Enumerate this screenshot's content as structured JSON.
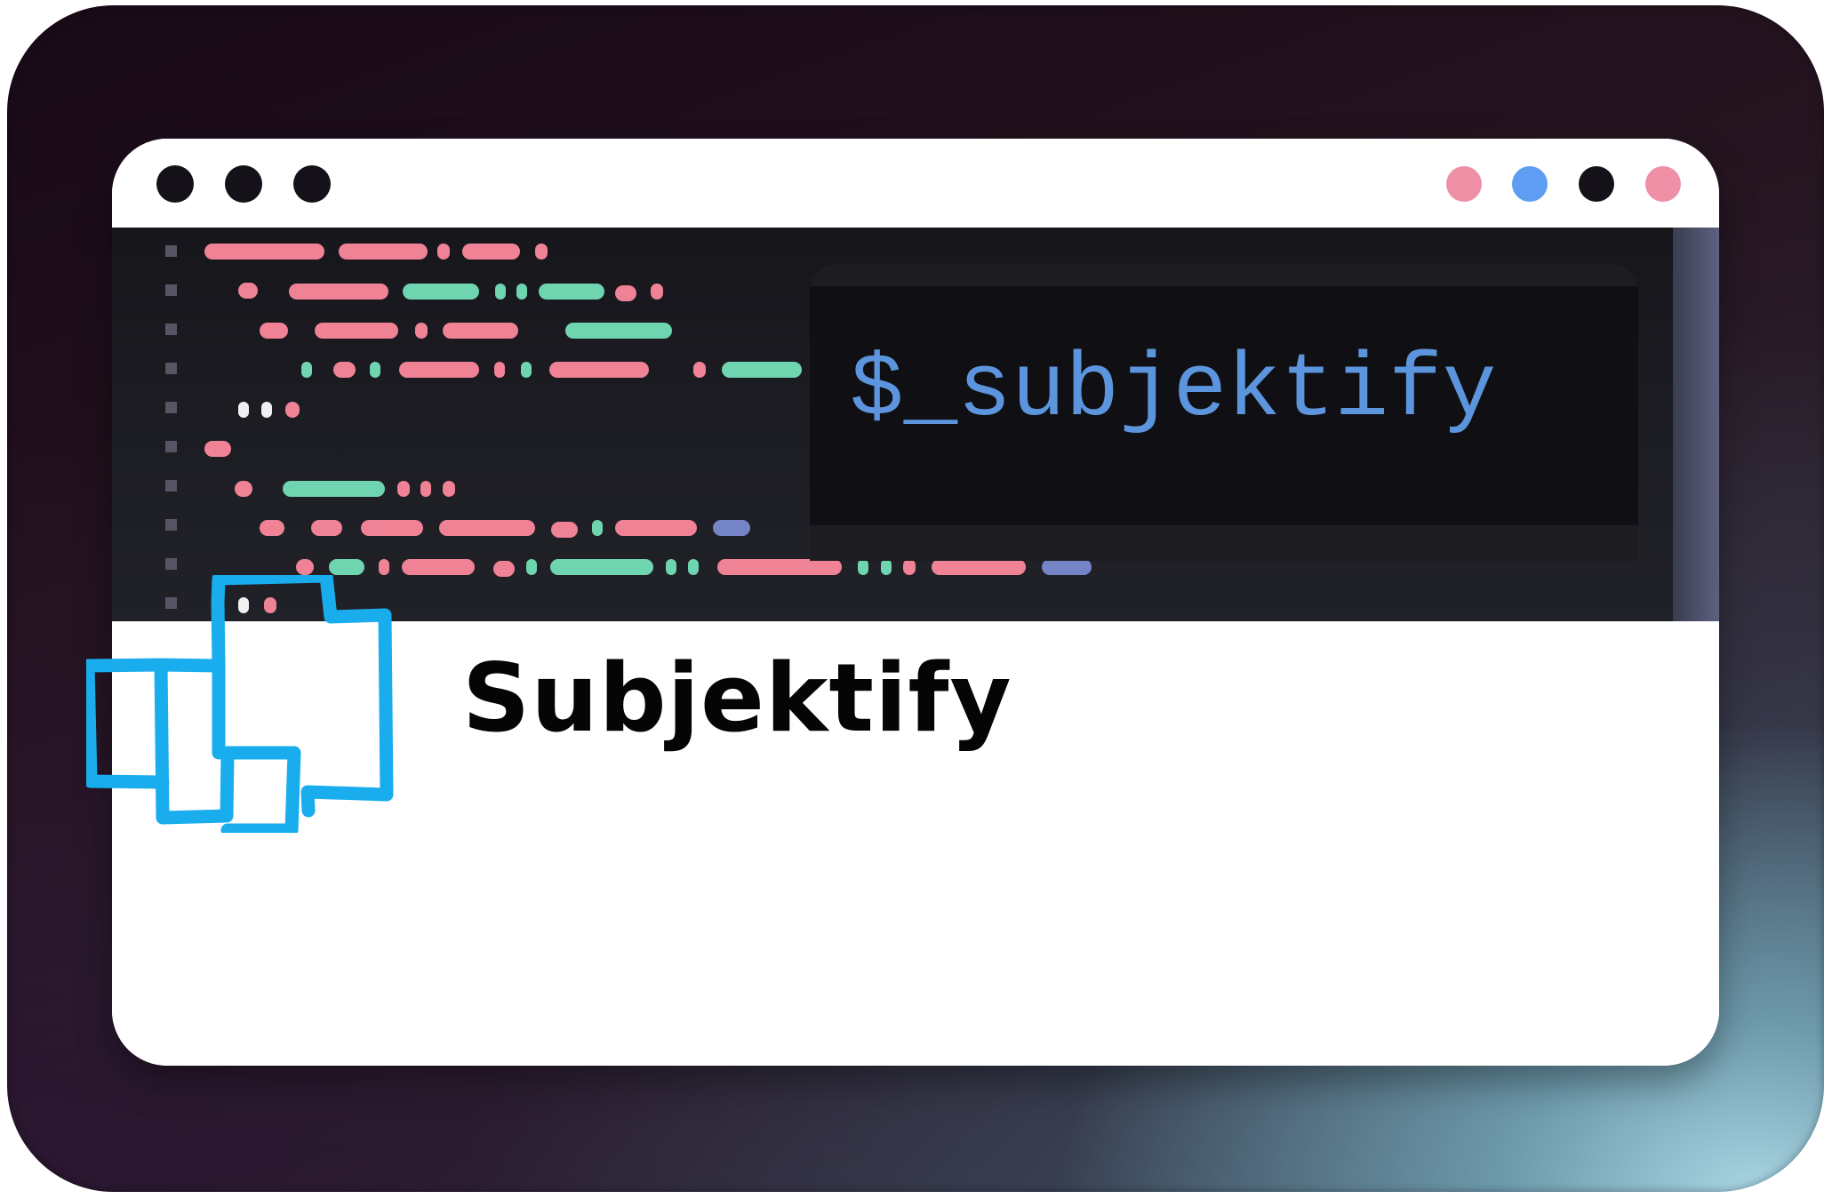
{
  "window": {
    "title_dots_left": [
      "dot",
      "dot",
      "dot"
    ],
    "title_dots_right": [
      "#ef8fa6",
      "#5f9df2",
      "#141218",
      "#ef8fa6"
    ]
  },
  "terminal": {
    "command": "$_subjektify"
  },
  "brand": {
    "name": "Subjektify",
    "logo_icon": "overlapping-squares-icon"
  },
  "colors": {
    "pink": "#ef8295",
    "green": "#6fd4b0",
    "blue": "#7484c6",
    "logo_blue": "#19adee"
  }
}
